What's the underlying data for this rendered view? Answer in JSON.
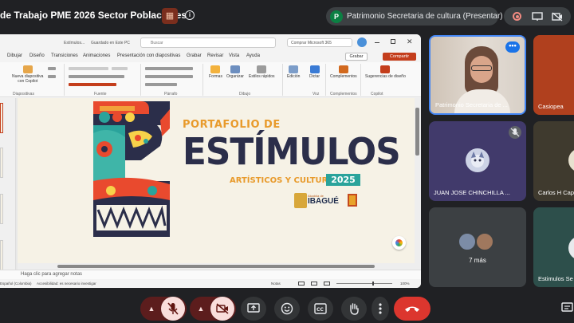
{
  "meet": {
    "title": "de Trabajo PME 2026 Sector Poblaciones",
    "presenter_badge_letter": "P",
    "presenter_label": "Patrimonio Secretaria de cultura (Presentar)"
  },
  "ppt": {
    "file_name": "Estímulos...",
    "saved_status": "Guardado en Este PC",
    "search_placeholder": "Buscar",
    "copilot_label": "Comprar Microsoft 365",
    "menu": [
      "Dibujar",
      "Diseño",
      "Transiciones",
      "Animaciones",
      "Presentación con diapositivas",
      "Grabar",
      "Revisar",
      "Vista",
      "Ayuda"
    ],
    "grabar_label": "Grabar",
    "compartir_label": "Compartir",
    "ribbon_buttons": {
      "new_slide": "Nueva diapositiva",
      "with_copilot": "con Copilot",
      "shapes": "Formas",
      "arrange": "Organizar",
      "quick_styles": "Estilos rápidos",
      "editing": "Edición",
      "dictate": "Dictar",
      "addins": "Complementos",
      "design_ideas": "Sugerencias de diseño"
    },
    "ribbon_groups": [
      "Diapositivas",
      "Fuente",
      "Párrafo",
      "Dibujo",
      "Voz",
      "Complementos",
      "Copilot"
    ],
    "notes_placeholder": "Haga clic para agregar notas",
    "status": {
      "language": "Español (Colombia)",
      "accessibility": "Accesibilidad: es necesario investigar",
      "notes": "Notas",
      "zoom": "100%"
    }
  },
  "slide": {
    "portafolio": "PORTAFOLIO DE",
    "estimulos": "ESTÍMULOS",
    "subtitle": "ARTÍSTICOS Y CULTURALES",
    "year": "2025",
    "org_small": "Alcaldía de",
    "org_name": "IBAGUÉ"
  },
  "participants": [
    {
      "name": "Patrimonio Secretaria de ...",
      "muted": false,
      "active_speaker": true
    },
    {
      "name": "Casiopea"
    },
    {
      "name": "JUAN JOSE CHINCHILLA ...",
      "muted": true
    },
    {
      "name": "Carlos H Cap"
    },
    {
      "name": "7 más"
    },
    {
      "name": "Estimulos Se"
    }
  ],
  "icons": {
    "info": "info-icon",
    "record": "record-icon",
    "mic_off": "mic-off-icon",
    "cam_off": "camera-off-icon",
    "present": "present-icon",
    "emoji": "emoji-icon",
    "captions": "captions-icon",
    "raise_hand": "hand-icon",
    "more": "more-vert-icon",
    "hangup": "hangup-icon"
  },
  "colors": {
    "meet_bg": "#202124",
    "hangup": "#dc362e",
    "accent_orange": "#c43e1c",
    "year_teal": "#2aa39b",
    "title_navy": "#2b2e4a"
  }
}
